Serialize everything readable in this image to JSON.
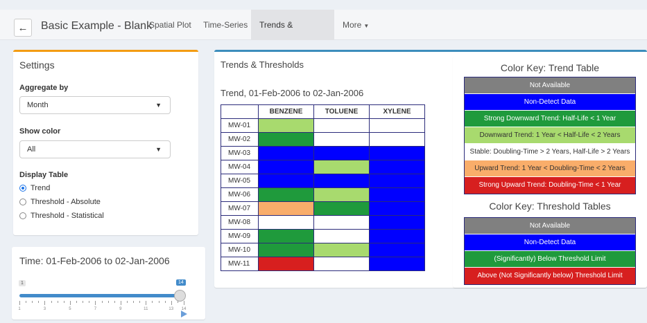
{
  "header": {
    "back_icon": "arrow-left-icon",
    "title": "Basic Example - Blank",
    "tabs": [
      {
        "label": "Spatial Plot"
      },
      {
        "label": "Time-Series"
      },
      {
        "label": "Trends & Thresholds"
      },
      {
        "label": "More"
      }
    ]
  },
  "settings": {
    "title": "Settings",
    "aggregate_label": "Aggregate by",
    "aggregate_value": "Month",
    "show_color_label": "Show color",
    "show_color_value": "All",
    "display_label": "Display Table",
    "options": [
      "Trend",
      "Threshold - Absolute",
      "Threshold - Statistical"
    ],
    "selected": "Trend"
  },
  "time": {
    "title": "Time: 01-Feb-2006 to 02-Jan-2006",
    "min": "1",
    "max": "14",
    "ticks": [
      "1",
      "3",
      "5",
      "7",
      "9",
      "11",
      "13",
      "14"
    ],
    "value_fraction": 1.0
  },
  "main": {
    "title": "Trends & Thresholds",
    "table_title": "Trend, 01-Feb-2006 to 02-Jan-2006",
    "columns": [
      "BENZENE",
      "TOLUENE",
      "XYLENE"
    ],
    "rows": [
      {
        "label": "MW-01",
        "cells": [
          "#a8da6e",
          "#ffffff",
          "#ffffff"
        ]
      },
      {
        "label": "MW-02",
        "cells": [
          "#1f9a3c",
          "#ffffff",
          "#ffffff"
        ]
      },
      {
        "label": "MW-03",
        "cells": [
          "#0000ff",
          "#0000ff",
          "#0000ff"
        ]
      },
      {
        "label": "MW-04",
        "cells": [
          "#0000ff",
          "#a8da6e",
          "#0000ff"
        ]
      },
      {
        "label": "MW-05",
        "cells": [
          "#0000ff",
          "#0000ff",
          "#0000ff"
        ]
      },
      {
        "label": "MW-06",
        "cells": [
          "#1f9a3c",
          "#a8da6e",
          "#0000ff"
        ]
      },
      {
        "label": "MW-07",
        "cells": [
          "#f9ad6a",
          "#1f9a3c",
          "#0000ff"
        ]
      },
      {
        "label": "MW-08",
        "cells": [
          "#ffffff",
          "#ffffff",
          "#0000ff"
        ]
      },
      {
        "label": "MW-09",
        "cells": [
          "#1f9a3c",
          "#ffffff",
          "#0000ff"
        ]
      },
      {
        "label": "MW-10",
        "cells": [
          "#1f9a3c",
          "#a8da6e",
          "#0000ff"
        ]
      },
      {
        "label": "MW-11",
        "cells": [
          "#d71f1f",
          "#ffffff",
          "#0000ff"
        ]
      }
    ]
  },
  "key": {
    "trend_title": "Color Key: Trend Table",
    "trend": [
      {
        "label": "Not Available",
        "bg": "#808080",
        "fg": "#ffffff"
      },
      {
        "label": "Non-Detect Data",
        "bg": "#0000ff",
        "fg": "#ffffff"
      },
      {
        "label": "Strong Downward Trend: Half-Life < 1 Year",
        "bg": "#1f9a3c",
        "fg": "#ffffff"
      },
      {
        "label": "Downward Trend: 1 Year < Half-Life < 2 Years",
        "bg": "#a8da6e",
        "fg": "#333333"
      },
      {
        "label": "Stable: Doubling-Time > 2 Years, Half-Life > 2 Years",
        "bg": "#ffffff",
        "fg": "#333333"
      },
      {
        "label": "Upward Trend: 1 Year < Doubling-Time < 2 Years",
        "bg": "#f9ad6a",
        "fg": "#333333"
      },
      {
        "label": "Strong Upward Trend: Doubling-Time < 1 Year",
        "bg": "#d71f1f",
        "fg": "#ffffff"
      }
    ],
    "threshold_title": "Color Key: Threshold Tables",
    "threshold": [
      {
        "label": "Not Available",
        "bg": "#808080",
        "fg": "#ffffff"
      },
      {
        "label": "Non-Detect Data",
        "bg": "#0000ff",
        "fg": "#ffffff"
      },
      {
        "label": "(Significantly) Below Threshold Limit",
        "bg": "#1f9a3c",
        "fg": "#ffffff"
      },
      {
        "label": "Above (Not Significantly below) Threshold Limit",
        "bg": "#d71f1f",
        "fg": "#ffffff"
      }
    ]
  }
}
